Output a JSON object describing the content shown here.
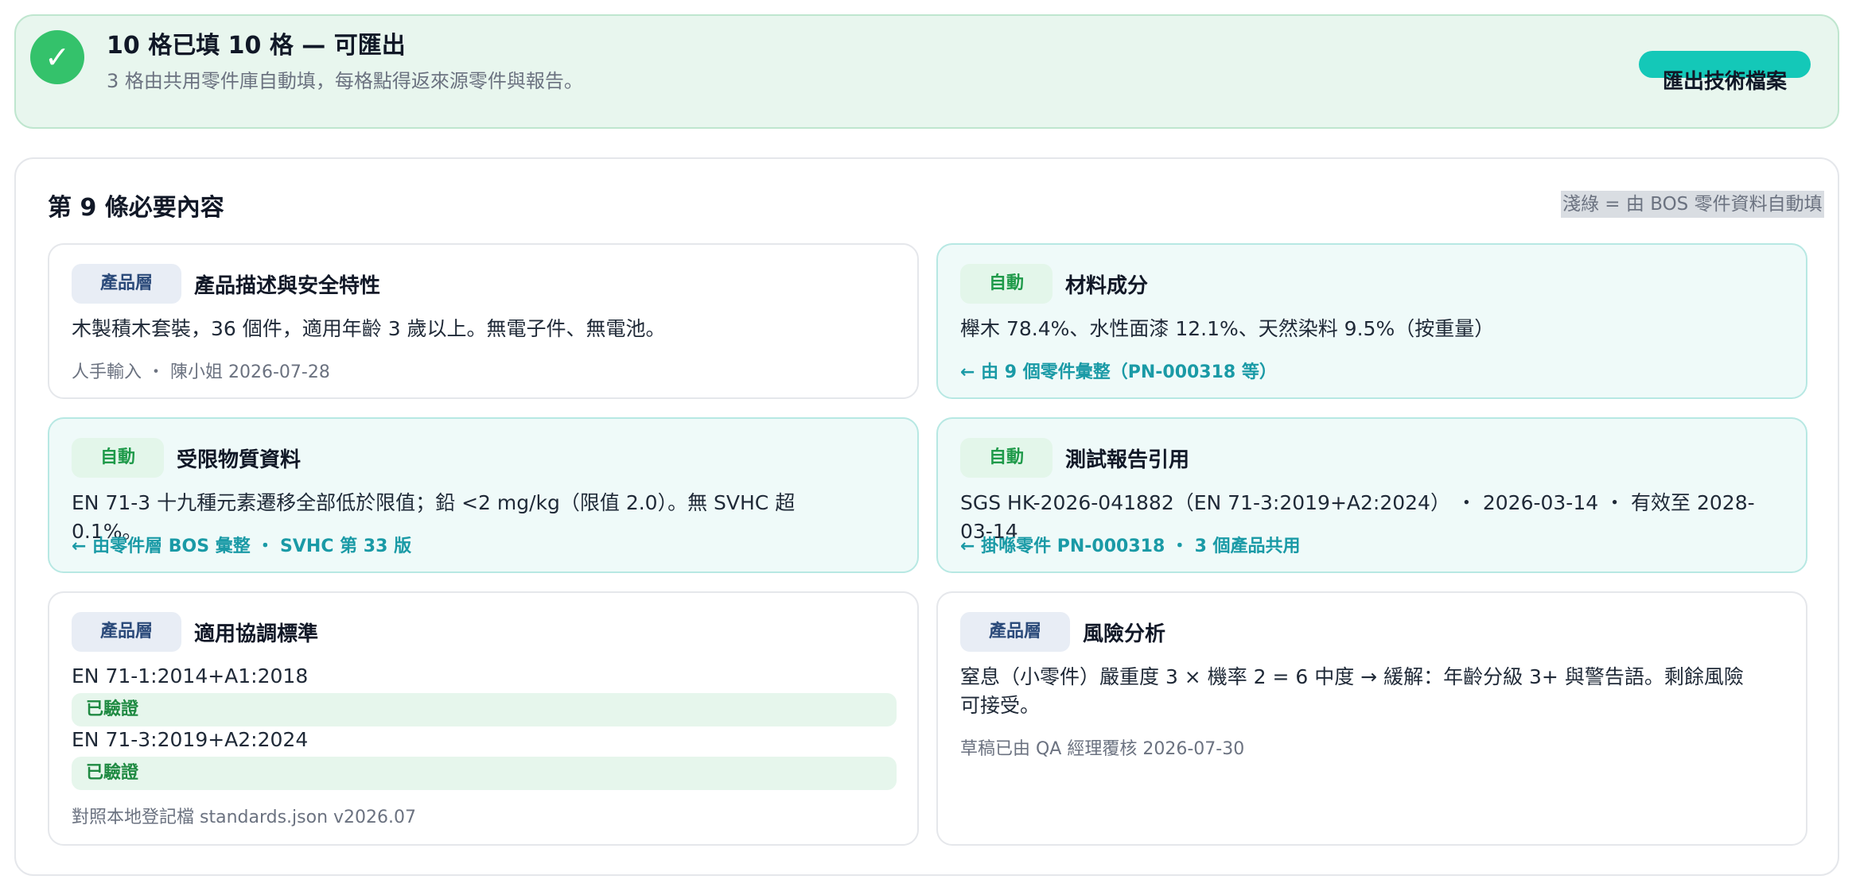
{
  "banner": {
    "check_icon": "✓",
    "title": "10 格已填 10 格 — 可匯出",
    "subtitle": "3 格由共用零件庫自動填，每格點得返來源零件與報告。",
    "export_label": "匯出技術檔案"
  },
  "panel": {
    "title": "第 9 條必要內容",
    "hint": "淺綠 = 由 BOS 零件資料自動填"
  },
  "cards": [
    {
      "badge": "產品層",
      "title": "產品描述與安全特性",
      "body": "木製積木套裝，36 個件，適用年齡 3 歲以上。無電子件、無電池。",
      "meta": "人手輸入 ・ 陳小姐 2026-07-28"
    },
    {
      "badge": "自動",
      "title": "材料成分",
      "body": "櫸木 78.4%、水性面漆 12.1%、天然染料 9.5%（按重量）",
      "link": "← 由 9 個零件彙整（PN-000318 等）"
    },
    {
      "badge": "自動",
      "title": "受限物質資料",
      "body": "EN 71-3 十九種元素遷移全部低於限值；鉛 <2 mg/kg（限值 2.0）。無 SVHC 超 0.1%。",
      "link": "← 由零件層 BOS 彙整 ・ SVHC 第 33 版"
    },
    {
      "badge": "自動",
      "title": "測試報告引用",
      "body": "SGS HK-2026-041882（EN 71-3:2019+A2:2024） ・ 2026-03-14 ・ 有效至 2028-03-14",
      "link": "← 掛喺零件 PN-000318 ・ 3 個產品共用"
    },
    {
      "badge": "產品層",
      "title": "適用協調標準",
      "standards": [
        {
          "name": "EN 71-1:2014+A1:2018",
          "status": "已驗證"
        },
        {
          "name": "EN 71-3:2019+A2:2024",
          "status": "已驗證"
        }
      ],
      "meta": "對照本地登記檔 standards.json v2026.07"
    },
    {
      "badge": "產品層",
      "title": "風險分析",
      "body": "窒息（小零件）嚴重度 3 × 機率 2 = 6 中度 → 緩解：年齡分級 3+ 與警告語。剩餘風險可接受。",
      "meta": "草稿已由 QA 經理覆核 2026-07-30"
    }
  ],
  "colors": {
    "accent_teal": "#14c8b8",
    "success_green": "#34c26b",
    "auto_card_bg": "#effaf9",
    "link_teal": "#1a9aa6"
  }
}
